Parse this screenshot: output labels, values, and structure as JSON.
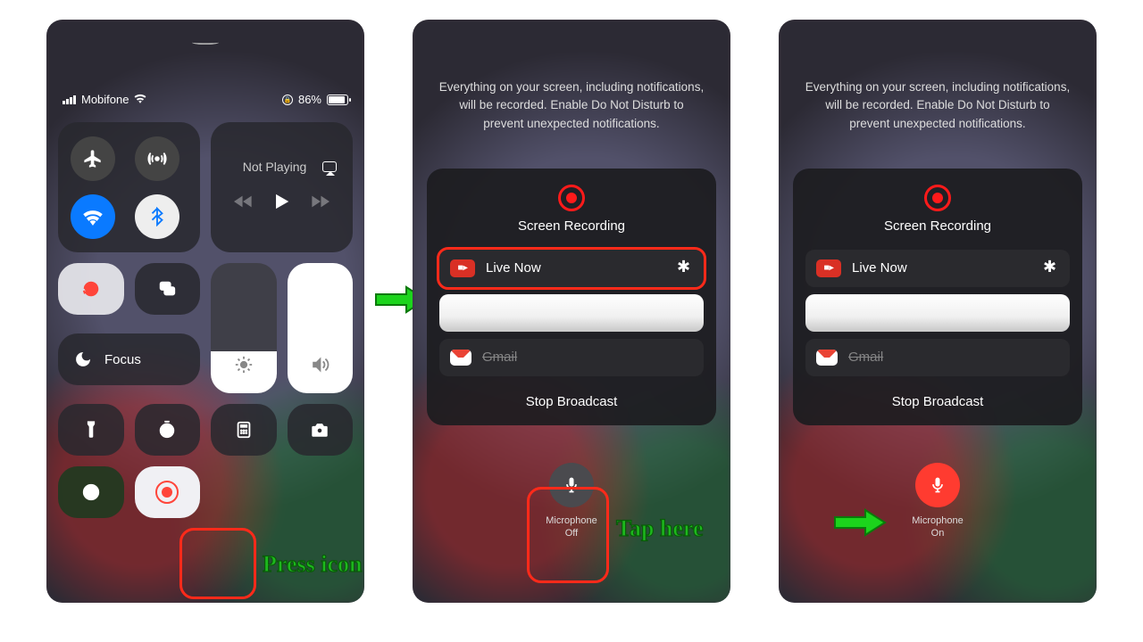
{
  "panel1": {
    "carrier": "Mobifone",
    "battery_pct": "86%",
    "media_status": "Not Playing",
    "focus_label": "Focus",
    "annotation": "Press icon"
  },
  "panel2": {
    "info": "Everything on your screen, including notifications, will be recorded. Enable Do Not Disturb to prevent unexpected notifications.",
    "card_title": "Screen Recording",
    "app_primary": "Live Now",
    "app_secondary": "Gmail",
    "stop_label": "Stop Broadcast",
    "mic_label_line1": "Microphone",
    "mic_label_line2": "Off",
    "annotation": "Tap here"
  },
  "panel3": {
    "info": "Everything on your screen, including notifications, will be recorded. Enable Do Not Disturb to prevent unexpected notifications.",
    "card_title": "Screen Recording",
    "app_primary": "Live Now",
    "app_secondary": "Gmail",
    "stop_label": "Stop Broadcast",
    "mic_label_line1": "Microphone",
    "mic_label_line2": "On"
  }
}
